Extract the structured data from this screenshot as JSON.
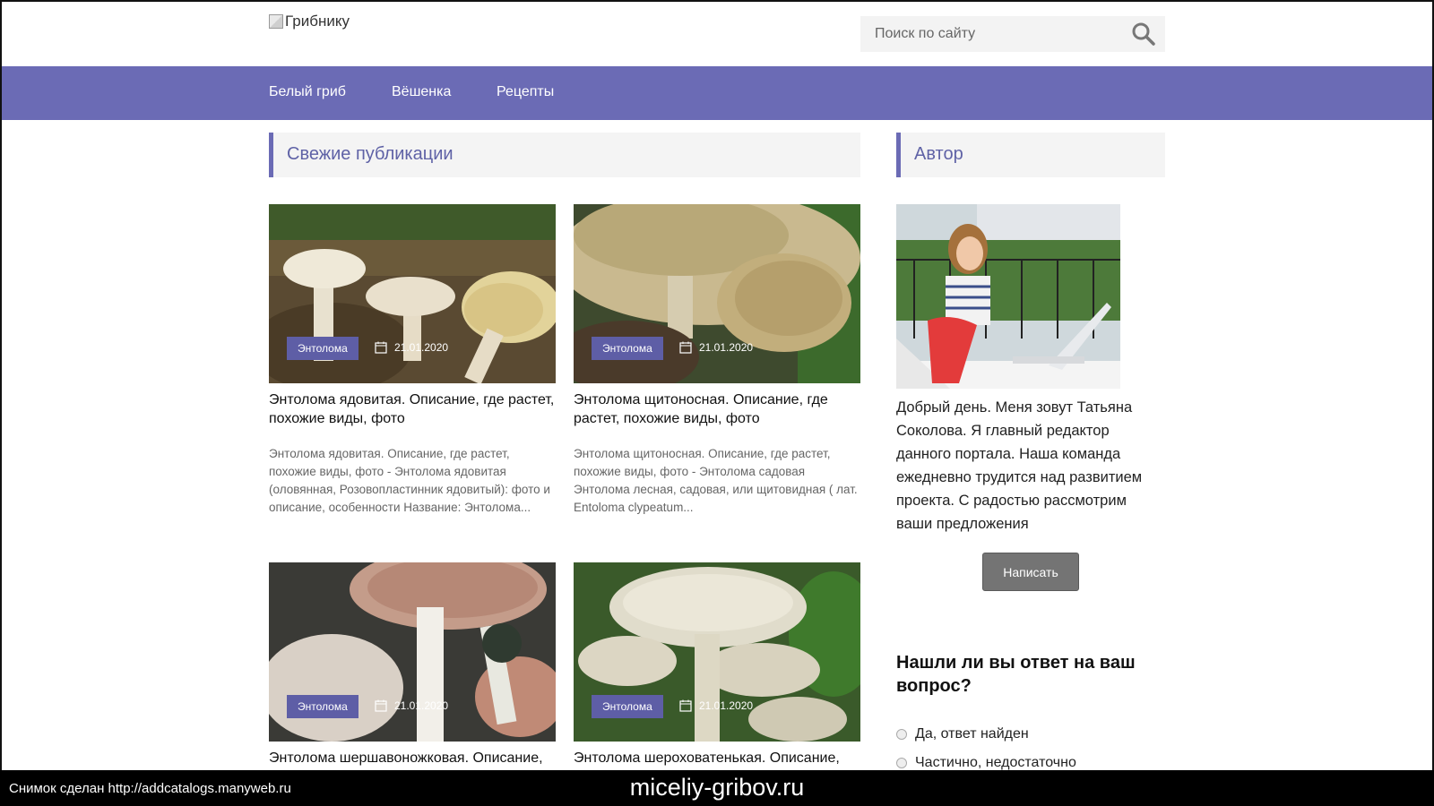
{
  "header": {
    "logo_alt": "Грибнику",
    "search": {
      "placeholder": "Поиск по сайту"
    }
  },
  "nav": {
    "items": [
      {
        "label": "Белый гриб"
      },
      {
        "label": "Вёшенка"
      },
      {
        "label": "Рецепты"
      }
    ]
  },
  "main": {
    "section_title": "Свежие публикации",
    "posts": [
      {
        "category": "Энтолома",
        "date": "21.01.2020",
        "title": "Энтолома ядовитая. Описание, где растет, похожие виды, фото",
        "excerpt": "Энтолома ядовитая. Описание, где растет, похожие виды, фото - Энтолома ядовитая (оловянная, Розовопластинник ядовитый): фото и описание, особенности Название: Энтолома..."
      },
      {
        "category": "Энтолома",
        "date": "21.01.2020",
        "title": "Энтолома щитоносная. Описание, где растет, похожие виды, фото",
        "excerpt": "Энтолома щитоносная. Описание, где растет, похожие виды, фото - Энтолома садовая Энтолома лесная, садовая, или щитовидная ( лат. Entoloma clypeatum..."
      },
      {
        "category": "Энтолома",
        "date": "21.01.2020",
        "title": "Энтолома шершавоножковая. Описание,",
        "excerpt": ""
      },
      {
        "category": "Энтолома",
        "date": "21.01.2020",
        "title": "Энтолома шероховатенькая. Описание,",
        "excerpt": ""
      }
    ]
  },
  "sidebar": {
    "author_title": "Автор",
    "author_text": "Добрый день. Меня зовут Татьяна Соколова. Я главный редактор данного портала. Наша команда ежедневно трудится над развитием проекта. С радостью рассмотрим ваши предложения",
    "write_button": "Написать",
    "poll": {
      "question": "Нашли ли вы ответ на ваш вопрос?",
      "options": [
        "Да, ответ найден",
        "Частично, недостаточно"
      ]
    }
  },
  "overlay": {
    "screenshot_note": "Снимок сделан http://addcatalogs.manyweb.ru",
    "domain": "miceliy-gribov.ru"
  },
  "colors": {
    "accent": "#6b6bb5",
    "badge": "#5e5ea6",
    "button": "#747474"
  }
}
